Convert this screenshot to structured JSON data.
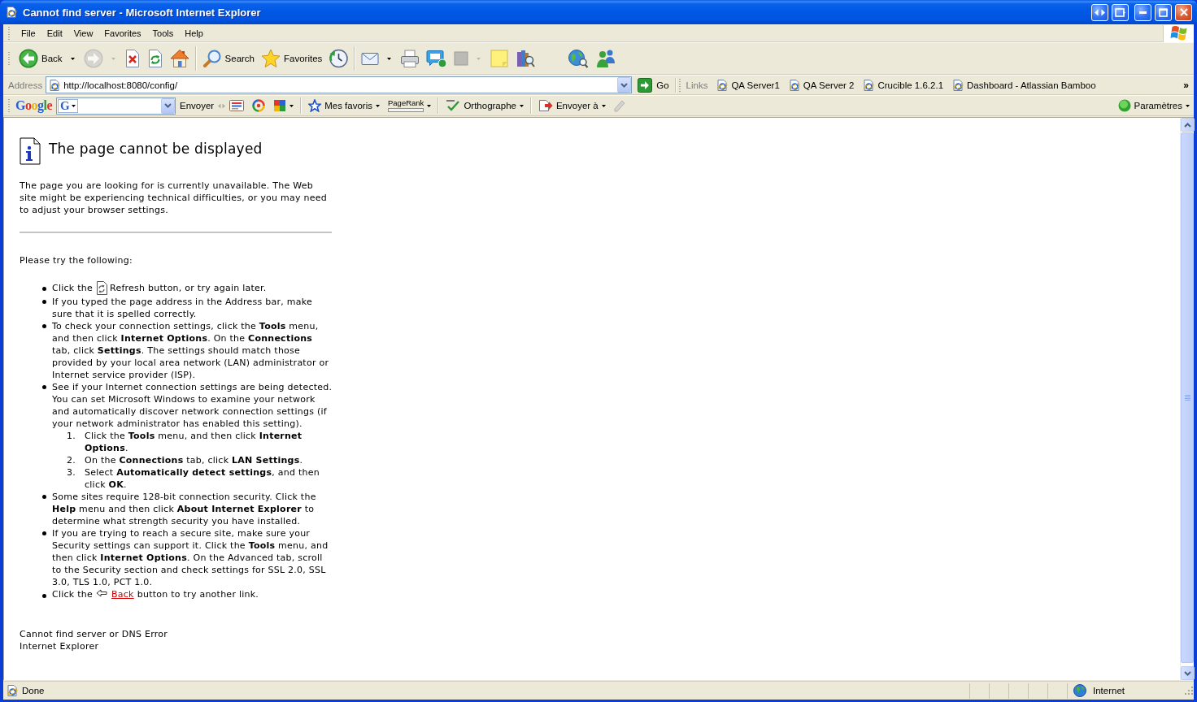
{
  "window": {
    "title": "Cannot find server - Microsoft Internet Explorer"
  },
  "menu_bar": {
    "items": [
      "File",
      "Edit",
      "View",
      "Favorites",
      "Tools",
      "Help"
    ]
  },
  "toolbar": {
    "groups": [
      {
        "divider": false,
        "buttons": [
          {
            "kind": "back",
            "label": "Back",
            "dropdown": true,
            "disabled": false
          },
          {
            "kind": "forward",
            "dropdown": true,
            "disabled": true
          },
          {
            "kind": "stop",
            "dropdown": false,
            "disabled": false
          },
          {
            "kind": "refresh",
            "dropdown": false,
            "disabled": false
          },
          {
            "kind": "home",
            "dropdown": false,
            "disabled": false
          }
        ]
      },
      {
        "divider": true,
        "buttons": [
          {
            "kind": "search",
            "label": "Search",
            "dropdown": false,
            "disabled": false
          },
          {
            "kind": "favorites",
            "label": "Favorites",
            "dropdown": false,
            "disabled": false
          },
          {
            "kind": "history",
            "dropdown": false,
            "disabled": false
          }
        ]
      },
      {
        "divider": true,
        "buttons": [
          {
            "kind": "mail",
            "dropdown": true,
            "disabled": false
          },
          {
            "kind": "print",
            "dropdown": false,
            "disabled": false
          },
          {
            "kind": "phone",
            "dropdown": false,
            "disabled": false
          },
          {
            "kind": "tool",
            "dropdown": true,
            "disabled": true
          },
          {
            "kind": "note",
            "dropdown": false,
            "disabled": false
          },
          {
            "kind": "research",
            "dropdown": false,
            "disabled": false
          }
        ]
      },
      {
        "divider": false,
        "buttons": [
          {
            "kind": "globe_search",
            "dropdown": false,
            "disabled": false
          },
          {
            "kind": "people",
            "dropdown": false,
            "disabled": false
          }
        ]
      }
    ]
  },
  "address_bar": {
    "label": "Address",
    "url": "http://localhost:8080/config/",
    "go": "Go"
  },
  "links_bar": {
    "label": "Links",
    "items": [
      "QA Server1",
      "QA Server 2",
      "Crucible 1.6.2.1",
      "Dashboard - Atlassian Bamboo"
    ],
    "more": "»"
  },
  "google_toolbar": {
    "logo": "Google",
    "engine": "G",
    "send": "Envoyer",
    "groups": [
      {
        "divider": false,
        "buttons": [
          {
            "kind": "card",
            "dropdown": false,
            "disabled": false
          },
          {
            "kind": "swirl",
            "dropdown": false,
            "disabled": false
          },
          {
            "kind": "puzzle",
            "dropdown": true,
            "disabled": false
          }
        ]
      },
      {
        "divider": true,
        "buttons": [
          {
            "kind": "bookmarks",
            "label": "Mes favoris",
            "dropdown": true,
            "disabled": false
          },
          {
            "kind": "pagerank",
            "label": "PageRank",
            "level": 0,
            "dropdown": true,
            "disabled": false
          }
        ]
      },
      {
        "divider": true,
        "buttons": [
          {
            "kind": "spelling",
            "label": "Orthographe",
            "dropdown": true,
            "disabled": false
          }
        ]
      },
      {
        "divider": true,
        "buttons": [
          {
            "kind": "send",
            "label": "Envoyer à",
            "dropdown": true,
            "disabled": false
          },
          {
            "kind": "pencil",
            "dropdown": false,
            "disabled": true
          }
        ]
      }
    ],
    "settings": "Paramètres"
  },
  "page": {
    "heading": "The page cannot be displayed",
    "intro": "The page you are looking for is currently unavailable. The Web site might be experiencing technical difficulties, or you may need to adjust your browser settings.",
    "prompt": "Please try the following:",
    "steps": [
      {
        "kind": "refresh",
        "before": "Click the",
        "after": "Refresh button, or try again later."
      },
      {
        "kind": "text",
        "text": "If you typed the page address in the Address bar, make sure that it is spelled correctly."
      },
      {
        "kind": "text",
        "text": "To check your connection settings, click the **Tools** menu, and then click **Internet Options**. On the **Connections** tab, click **Settings**. The settings should match those provided by your local area network (LAN) administrator or Internet service provider (ISP)."
      },
      {
        "kind": "text",
        "text": "See if your Internet connection settings are being detected. You can set Microsoft Windows to examine your network and automatically discover network connection settings (if your network administrator has enabled this setting).",
        "substeps": [
          {
            "number": "1.",
            "text": "Click the **Tools** menu, and then click **Internet Options**."
          },
          {
            "number": "2.",
            "text": "On the **Connections** tab, click **LAN Settings**."
          },
          {
            "number": "3.",
            "text": "Select **Automatically detect settings**, and then click **OK**."
          }
        ]
      },
      {
        "kind": "text",
        "text": "Some sites require 128-bit connection security. Click the **Help** menu and then click **About Internet Explorer** to determine what strength security you have installed."
      },
      {
        "kind": "text",
        "text": "If you are trying to reach a secure site, make sure your Security settings can support it. Click the **Tools** menu, and then click **Internet Options**. On the Advanced tab, scroll to the Security section and check settings for SSL 2.0, SSL 3.0, TLS 1.0, PCT 1.0."
      },
      {
        "kind": "back_link",
        "before": "Click the",
        "link": "Back",
        "after": "button to try another link."
      }
    ],
    "footer": [
      "Cannot find server or DNS Error",
      "Internet Explorer"
    ]
  },
  "status_bar": {
    "text": "Done",
    "zone": "Internet"
  }
}
